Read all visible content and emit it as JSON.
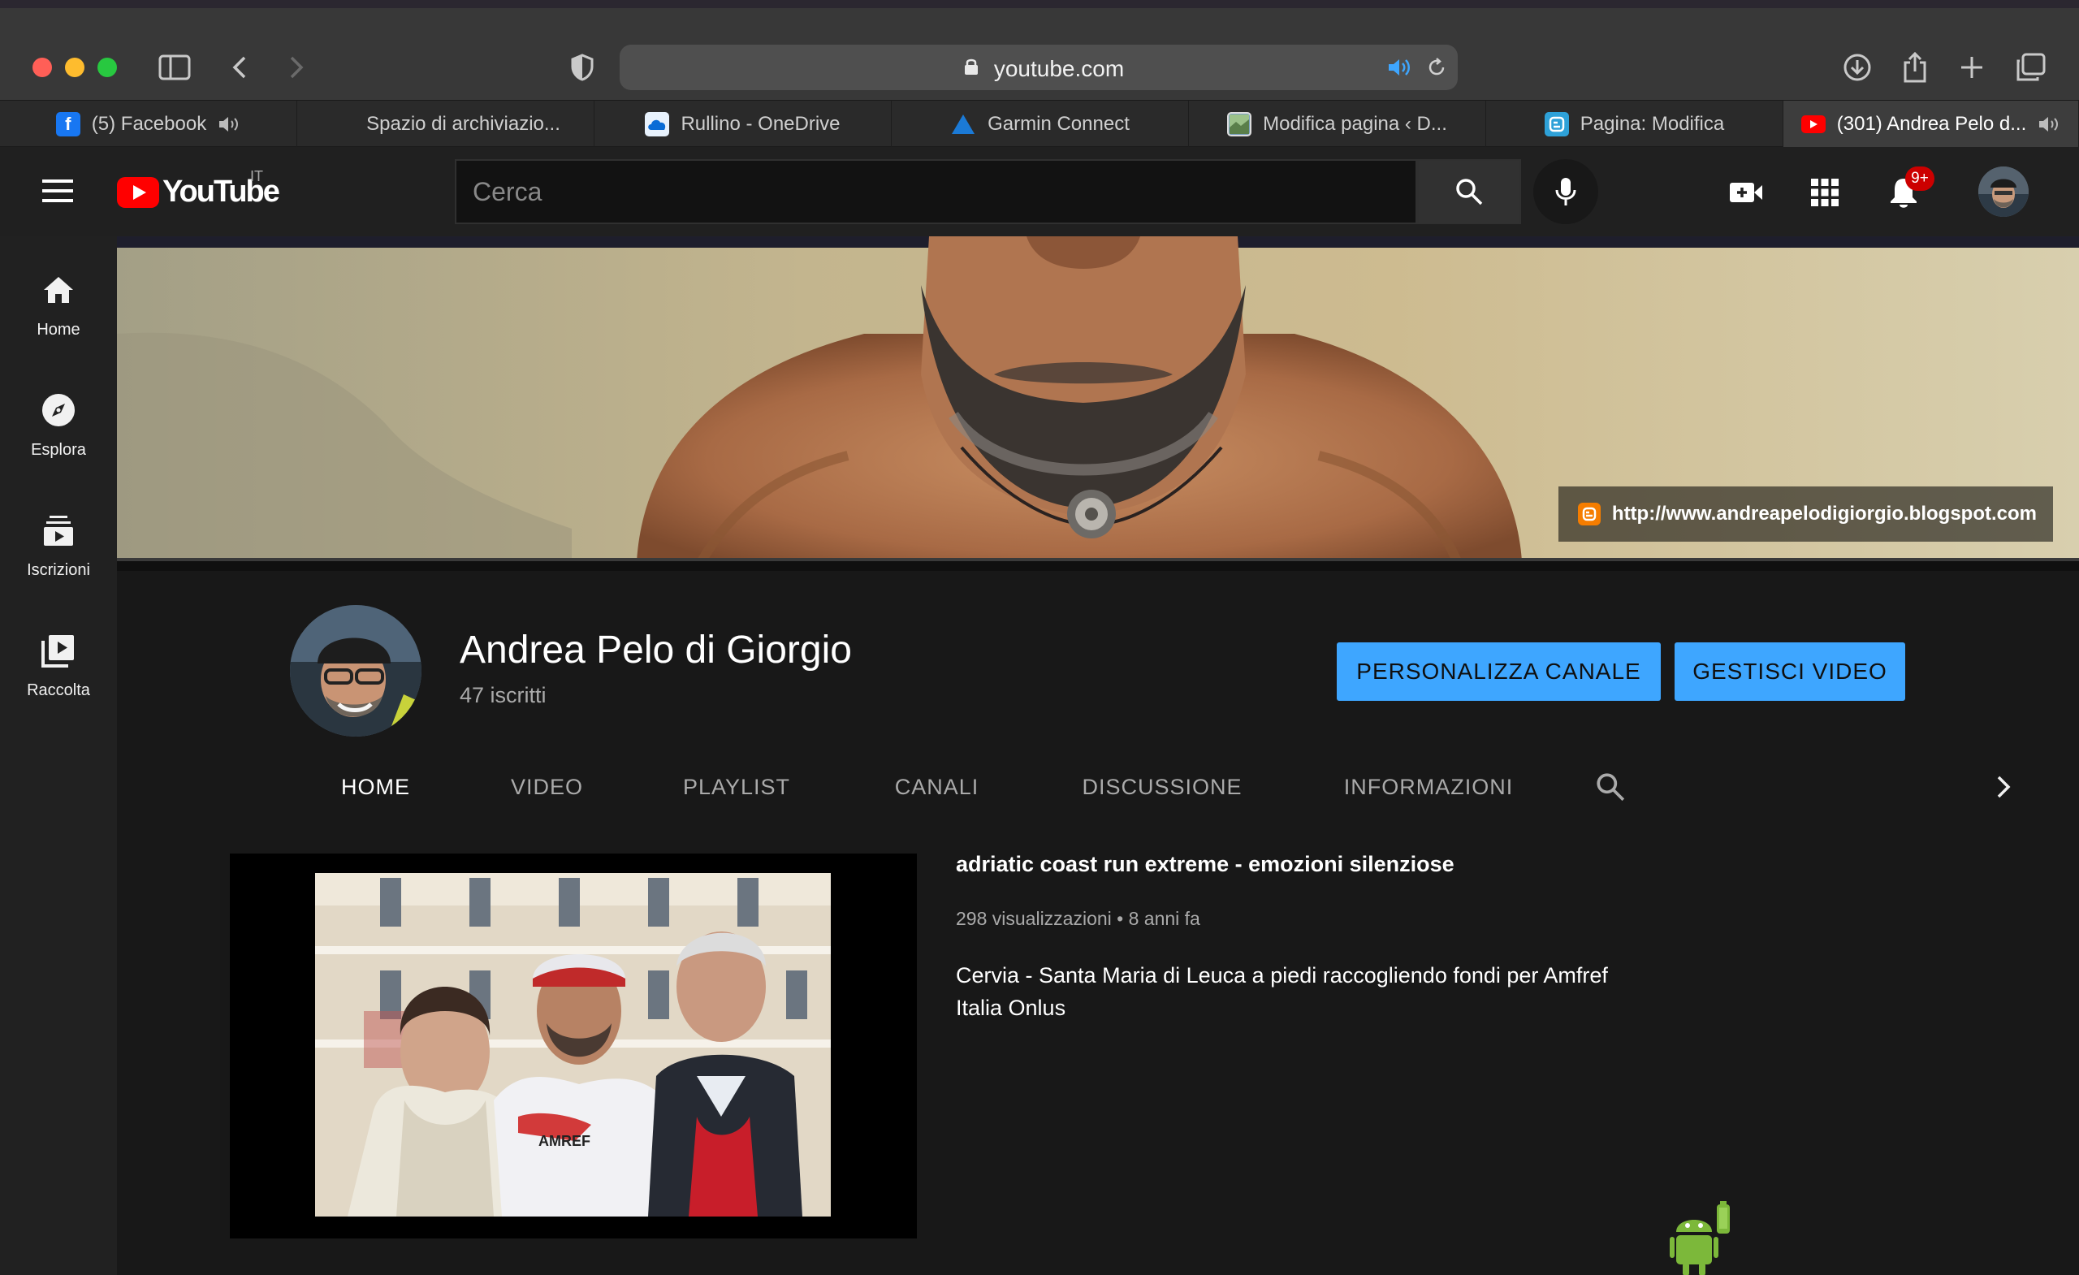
{
  "browser": {
    "url": "youtube.com",
    "tabs": [
      {
        "title": "(5) Facebook",
        "icon": "facebook-icon",
        "active": false
      },
      {
        "title": "Spazio di archiviazio...",
        "icon": "microsoft-icon",
        "active": false
      },
      {
        "title": "Rullino - OneDrive",
        "icon": "onedrive-icon",
        "active": false
      },
      {
        "title": "Garmin Connect",
        "icon": "garmin-icon",
        "active": false
      },
      {
        "title": "Modifica pagina ‹ D...",
        "icon": "map-icon",
        "active": false
      },
      {
        "title": "Pagina: Modifica",
        "icon": "blogger-icon",
        "active": false
      },
      {
        "title": "(301) Andrea Pelo d...",
        "icon": "youtube-icon",
        "active": true
      }
    ]
  },
  "youtube": {
    "logo_text": "YouTube",
    "country_code": "IT",
    "search_placeholder": "Cerca",
    "notification_count": "9+",
    "sidebar": [
      {
        "label": "Home",
        "icon": "home-icon"
      },
      {
        "label": "Esplora",
        "icon": "compass-icon"
      },
      {
        "label": "Iscrizioni",
        "icon": "subscriptions-icon"
      },
      {
        "label": "Raccolta",
        "icon": "library-icon"
      }
    ]
  },
  "channel": {
    "banner_link": "http://www.andreapelodigiorgio.blogspot.com",
    "name": "Andrea Pelo di Giorgio",
    "subscribers": "47 iscritti",
    "customize_button": "PERSONALIZZA CANALE",
    "manage_button": "GESTISCI VIDEO",
    "tabs": [
      "HOME",
      "VIDEO",
      "PLAYLIST",
      "CANALI",
      "DISCUSSIONE",
      "INFORMAZIONI"
    ],
    "active_tab": "HOME"
  },
  "featured_video": {
    "title": "adriatic coast run extreme - emozioni silenziose",
    "meta": "298 visualizzazioni • 8 anni fa",
    "description": "Cervia - Santa Maria di Leuca a piedi  raccogliendo fondi per Amfref Italia Onlus",
    "shirt_text": "AMREF"
  },
  "colors": {
    "accent_blue": "#3ea6ff",
    "youtube_red": "#ff0000",
    "badge_red": "#cc0000"
  }
}
